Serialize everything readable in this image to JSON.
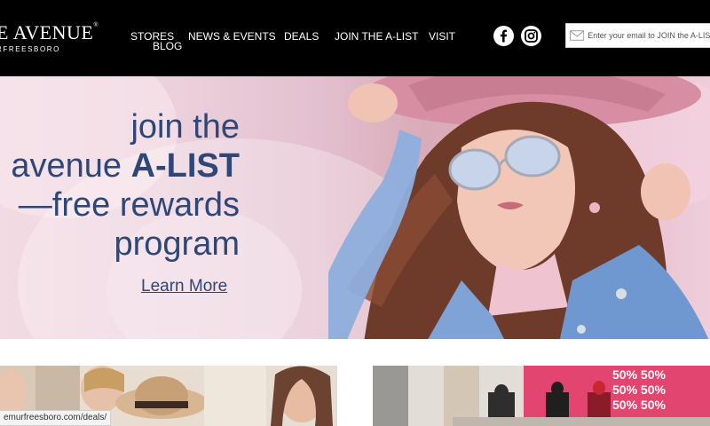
{
  "header": {
    "logo_main": "E AVENUE",
    "logo_sub": "RFREESBORO",
    "nav": [
      {
        "label": "STORES"
      },
      {
        "label": "BLOG"
      },
      {
        "label": "NEWS & EVENTS"
      },
      {
        "label": "DEALS"
      },
      {
        "label": "JOIN THE A-LIST"
      },
      {
        "label": "VISIT"
      }
    ],
    "social": [
      "facebook-icon",
      "instagram-icon"
    ],
    "email_placeholder": "Enter your email to JOIN the A-LIST"
  },
  "hero": {
    "line1": "join the",
    "line2_prefix": "avenue ",
    "line2_bold": "A-LIST",
    "line3": "—free rewards",
    "line4": "program",
    "cta": "Learn More"
  },
  "status_bar": {
    "url": "emurfreesboro.com/deals/"
  },
  "colors": {
    "header_bg": "#000000",
    "hero_text": "#2e4777",
    "sale_sign": "#e0456e"
  },
  "cards": {
    "right_sale_text": [
      "50%",
      "50%",
      "50%",
      "50%",
      "50%",
      "50%"
    ]
  }
}
